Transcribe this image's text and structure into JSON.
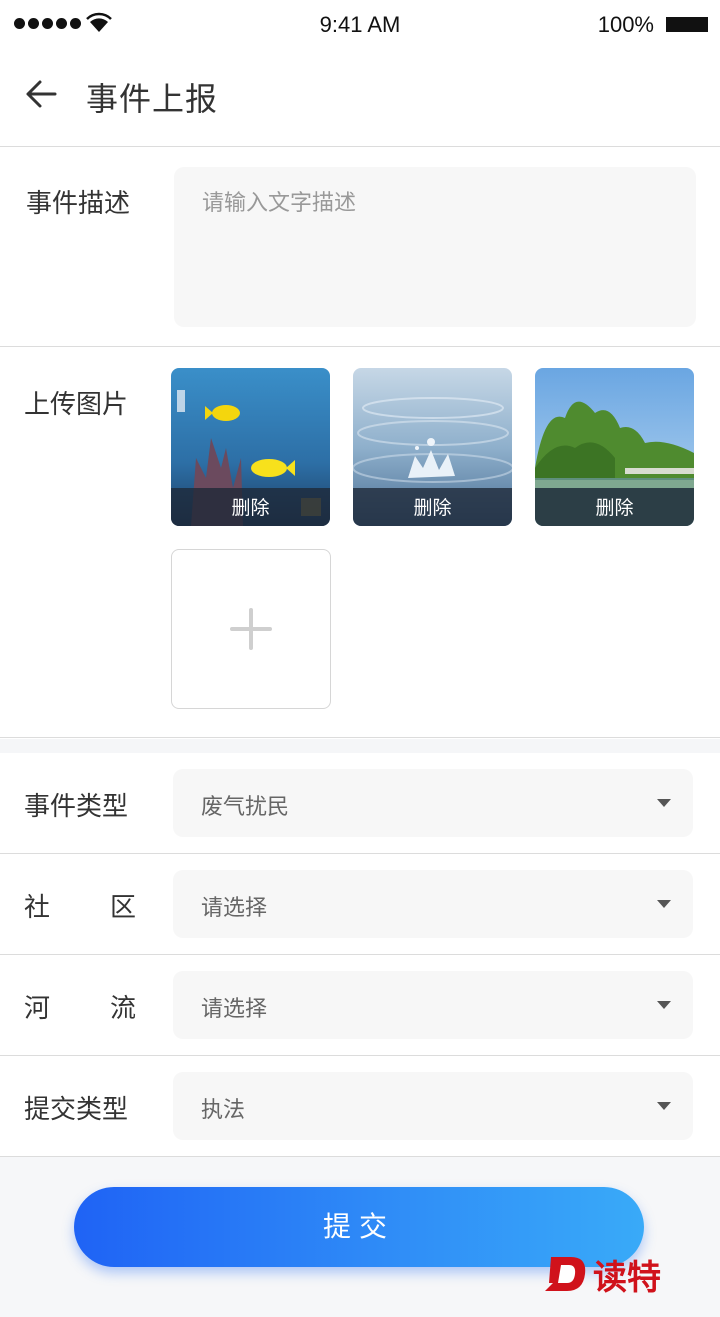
{
  "status_bar": {
    "time": "9:41 AM",
    "battery": "100%"
  },
  "header": {
    "title": "事件上报",
    "back_icon": "arrow-left-icon"
  },
  "description": {
    "label": "事件描述",
    "placeholder": "请输入文字描述",
    "value": ""
  },
  "upload": {
    "label": "上传图片",
    "images": [
      {
        "subject": "aquarium fish",
        "delete_label": "删除"
      },
      {
        "subject": "water splash",
        "delete_label": "删除"
      },
      {
        "subject": "lakeside trees",
        "delete_label": "删除"
      }
    ],
    "add_icon": "plus-icon"
  },
  "fields": [
    {
      "label": "事件类型",
      "value": "废气扰民"
    },
    {
      "label": "社区",
      "label_chars": [
        "社",
        "区"
      ],
      "value": "请选择"
    },
    {
      "label": "河流",
      "label_chars": [
        "河",
        "流"
      ],
      "value": "请选择"
    },
    {
      "label": "提交类型",
      "value": "执法"
    }
  ],
  "submit": {
    "label": "提交"
  },
  "watermark": {
    "text": "读特"
  },
  "colors": {
    "button_gradient_start": "#1f63f5",
    "button_gradient_end": "#39aaf8",
    "watermark_red": "#d0121b",
    "input_bg": "#f7f7f7"
  }
}
